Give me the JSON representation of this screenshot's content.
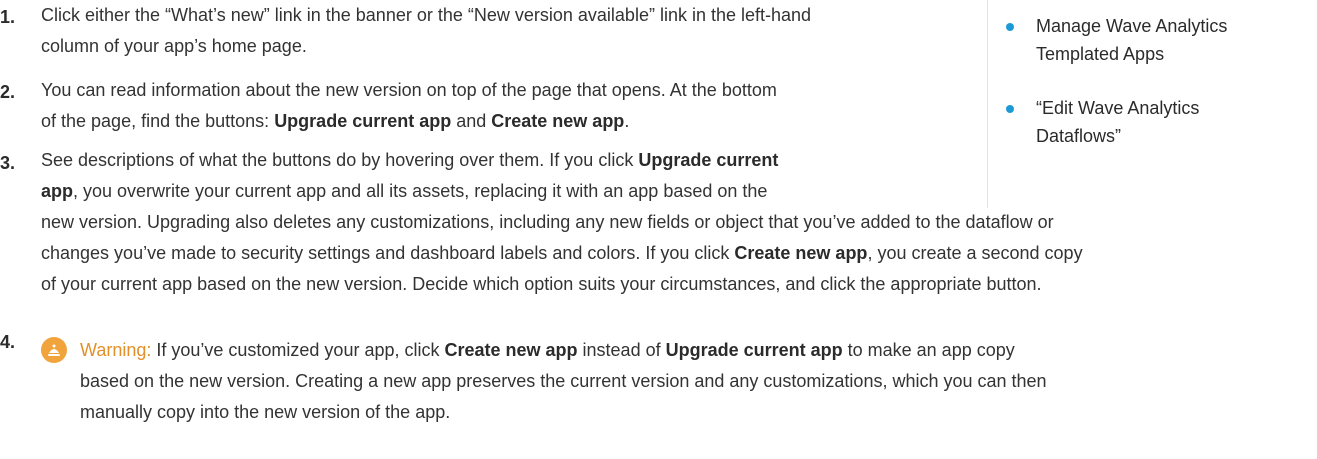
{
  "steps": [
    {
      "number": "1.",
      "lines": [
        [
          "Click either the “What’s new” link in the banner or the “New version available” link in the left-hand"
        ],
        [
          "column of your app’s home page."
        ]
      ]
    },
    {
      "number": "2.",
      "line1": "You can read information about the new version on top of the page that opens. At the bottom",
      "line2_pre": "of the page, find the buttons: ",
      "line2_b1": "Upgrade current app",
      "line2_mid": " and ",
      "line2_b2": "Create new app",
      "line2_post": "."
    },
    {
      "number": "3.",
      "l1_pre": "See descriptions of what the buttons do by hovering over them. If you click ",
      "l1_b": "Upgrade current",
      "l2_b": "app",
      "l2_post": ", you overwrite your current app and all its assets, replacing it with an app based on the",
      "l3": "new version. Upgrading also deletes any customizations, including any new fields or object that you’ve added to the dataflow or",
      "l4_pre": "changes you’ve made to security settings and dashboard labels and colors. If you click ",
      "l4_b": "Create new app",
      "l4_post": ", you create a second copy",
      "l5": "of your current app based on the new version. Decide which option suits your circumstances, and click the appropriate button."
    },
    {
      "number": "4.",
      "warning_label": "Warning:",
      "w1_pre": " If you’ve customized your app, click ",
      "w1_b1": "Create new app",
      "w1_mid": " instead of ",
      "w1_b2": "Upgrade current app",
      "w1_post": " to make an app copy",
      "w2": "based on the new version. Creating a new app preserves the current version and any customizations, which you can then",
      "w3": "manually copy into the new version of the app."
    }
  ],
  "sidebar": {
    "items": [
      {
        "line1": "Manage Wave Analytics",
        "line2": "Templated Apps"
      },
      {
        "line1": "“Edit Wave Analytics",
        "line2": "Dataflows”"
      }
    ]
  },
  "colors": {
    "bullet": "#1b9ad6",
    "warning_icon": "#f1a33c",
    "warning_text": "#e2902a"
  },
  "icons": {
    "warning": "warning-icon"
  }
}
